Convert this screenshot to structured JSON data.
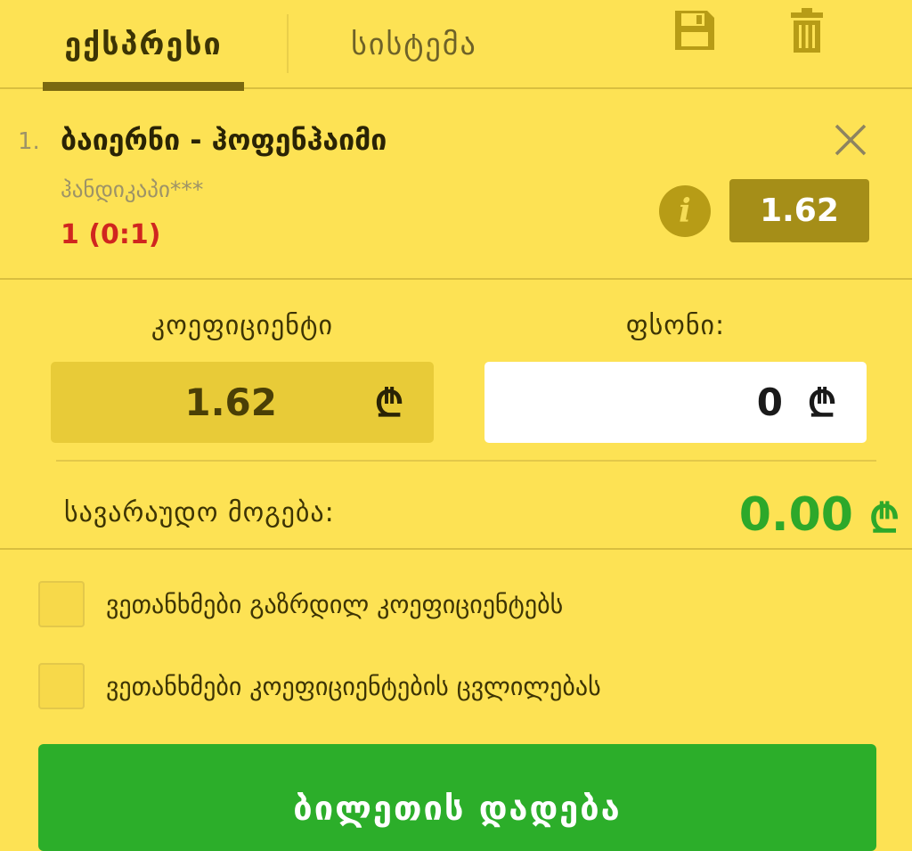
{
  "tabs": {
    "express": "ექსპრესი",
    "system": "სისტემა"
  },
  "icons": {
    "save": "save-icon",
    "trash": "trash-icon",
    "close": "close-icon",
    "info": "info-icon"
  },
  "bet": {
    "index": "1.",
    "match": "ბაიერნი - ჰოფენჰაიმი",
    "market": "ჰანდიკაპი***",
    "pick": "1 (0:1)",
    "odds": "1.62",
    "info_glyph": "i"
  },
  "form": {
    "coefficient_label": "კოეფიციენტი",
    "coefficient_value": "1.62",
    "stake_label": "ფსონი:",
    "stake_value": "0",
    "currency": "₾"
  },
  "win": {
    "label": "სავარაუდო მოგება:",
    "value": "0.00",
    "currency": "₾"
  },
  "options": [
    {
      "label": "ვეთანხმები გაზრდილ კოეფიციენტებს",
      "checked": false
    },
    {
      "label": "ვეთანხმები კოეფიციენტების ცვლილებას",
      "checked": false
    }
  ],
  "place_bet_label": "ბილეთის დადება",
  "colors": {
    "background": "#fde254",
    "accent_dark": "#a58e18",
    "win_green": "#2da82a",
    "pick_red": "#d0261f",
    "button_green": "#2cae2a"
  }
}
